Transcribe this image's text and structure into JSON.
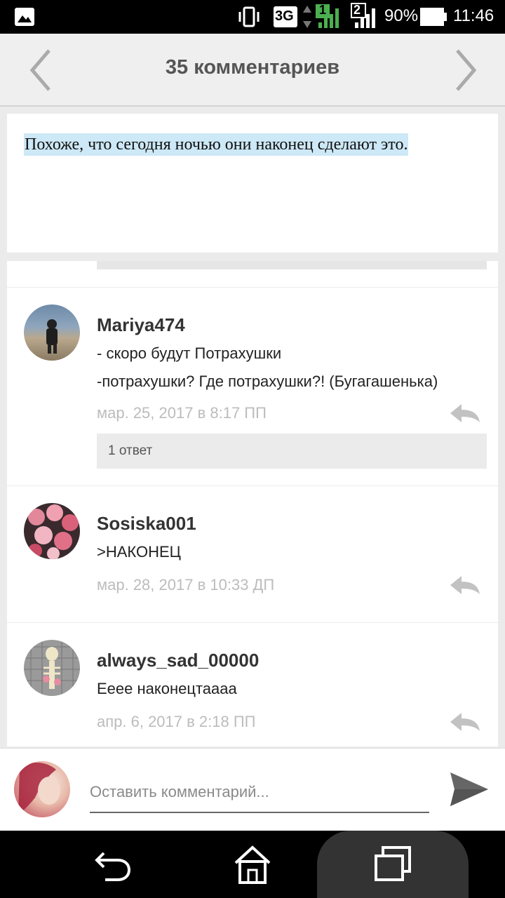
{
  "status_bar": {
    "network": "3G",
    "sim1": "1",
    "sim2": "2",
    "battery": "90%",
    "time": "11:46"
  },
  "header": {
    "title": "35 комментариев"
  },
  "post": {
    "text": "Похоже, что сегодня ночью они наконец сделают это."
  },
  "comments": [
    {
      "username": "Mariya474",
      "lines": [
        "- скоро будут Потрахушки",
        "-потрахушки? Где потрахушки?! (Бугагашенька)"
      ],
      "date": "мар. 25, 2017 в 8:17 ПП",
      "replies_label": "1 ответ"
    },
    {
      "username": "Sosiska001",
      "lines": [
        ">НАКОНЕЦ"
      ],
      "date": "мар. 28, 2017 в 10:33 ДП"
    },
    {
      "username": "always_sad_00000",
      "lines": [
        "Ееее наконецтаааа"
      ],
      "date": "апр. 6, 2017 в 2:18 ПП"
    }
  ],
  "composer": {
    "placeholder": "Оставить комментарий..."
  },
  "colors": {
    "highlight": "#cde8f6",
    "date_gray": "#bcbcbc",
    "header_bg": "#efefef"
  }
}
